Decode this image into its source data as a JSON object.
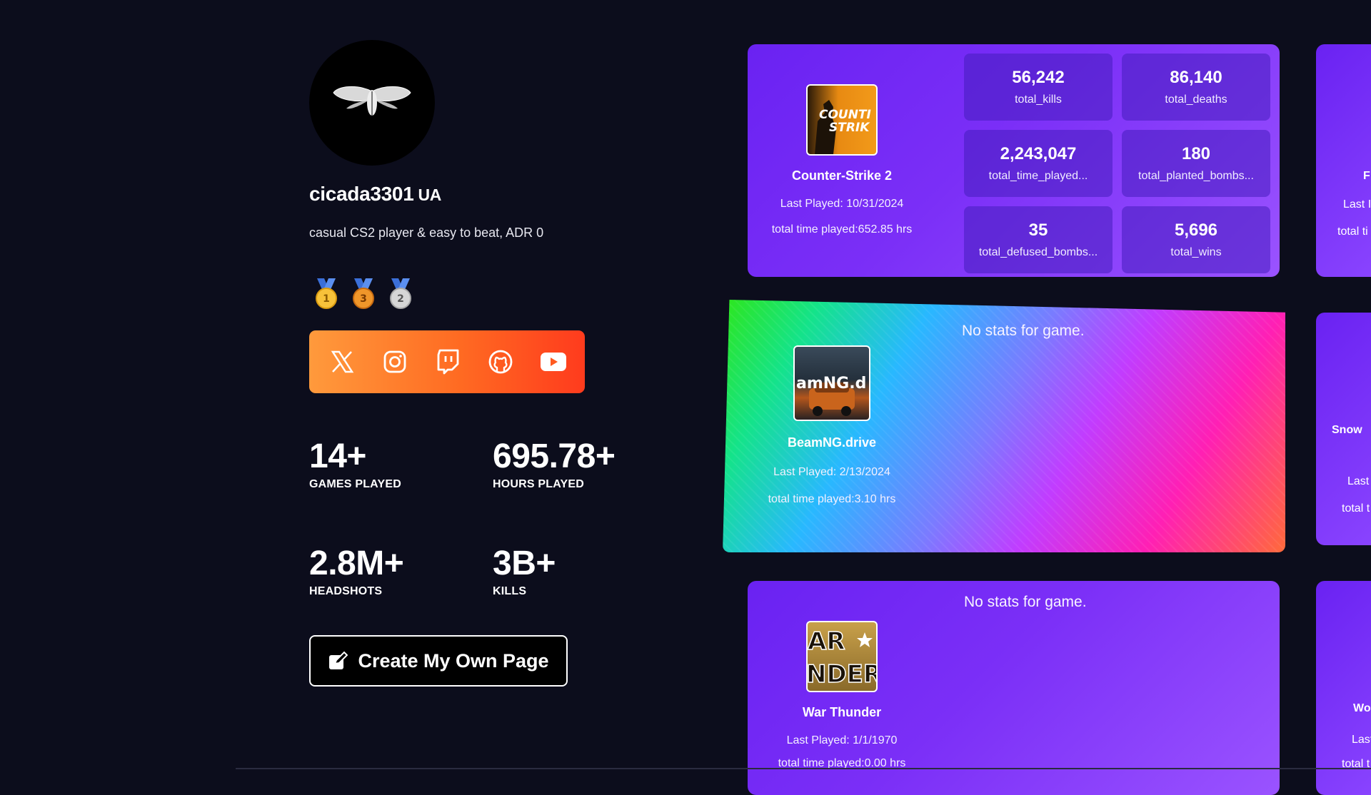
{
  "profile": {
    "username": "cicada3301",
    "country_code": "UA",
    "bio": "casual CS2 player & easy to beat, ADR 0",
    "avatar_icon": "cicada-icon",
    "medals": [
      {
        "icon": "gold-medal-icon",
        "label": "1"
      },
      {
        "icon": "bronze-medal-icon",
        "label": "3"
      },
      {
        "icon": "silver-medal-icon",
        "label": "2"
      }
    ],
    "socials": [
      "x-icon",
      "instagram-icon",
      "twitch-icon",
      "github-icon",
      "youtube-icon"
    ],
    "socials_gradient": [
      "#ff9a3c",
      "#ff3b1d"
    ]
  },
  "stats": {
    "games_played": {
      "value": "14+",
      "label": "GAMES PLAYED"
    },
    "hours_played": {
      "value": "695.78+",
      "label": "HOURS PLAYED"
    },
    "headshots": {
      "value": "2.8M+",
      "label": "HEADSHOTS"
    },
    "kills": {
      "value": "3B+",
      "label": "KILLS"
    }
  },
  "create_button": {
    "label": "Create My Own Page",
    "icon": "edit-icon"
  },
  "games": [
    {
      "name": "Counter-Strike 2",
      "last_played": "Last Played: 10/31/2024",
      "total_time": "total time played:652.85 hrs",
      "thumb_text": "COUNTER STRIKE",
      "stats": [
        {
          "value": "56,242",
          "key": "total_kills"
        },
        {
          "value": "86,140",
          "key": "total_deaths"
        },
        {
          "value": "2,243,047",
          "key": "total_time_played..."
        },
        {
          "value": "180",
          "key": "total_planted_bombs..."
        },
        {
          "value": "35",
          "key": "total_defused_bombs..."
        },
        {
          "value": "5,696",
          "key": "total_wins"
        }
      ]
    },
    {
      "name": "BeamNG.drive",
      "last_played": "Last Played: 2/13/2024",
      "total_time": "total time played:3.10 hrs",
      "thumb_text": "amNG.d",
      "no_stats": "No stats for game."
    },
    {
      "name": "War Thunder",
      "last_played": "Last Played: 1/1/1970",
      "total_time": "total time played:0.00 hrs",
      "thumb_text": "AR NDER",
      "no_stats": "No stats for game."
    }
  ],
  "peek_cards": {
    "c1": {
      "line1": "F",
      "line2": "Last I",
      "line3": "total ti"
    },
    "c2": {
      "line1": "Snow",
      "line2": "Last",
      "line3": "total t"
    },
    "c3": {
      "line1": "Wo",
      "line2": "Last",
      "line3": "total t"
    }
  },
  "colors": {
    "background": "#0c0d1c",
    "card_purple": "#7b2ff7",
    "stat_cell": "#4a22b8"
  }
}
